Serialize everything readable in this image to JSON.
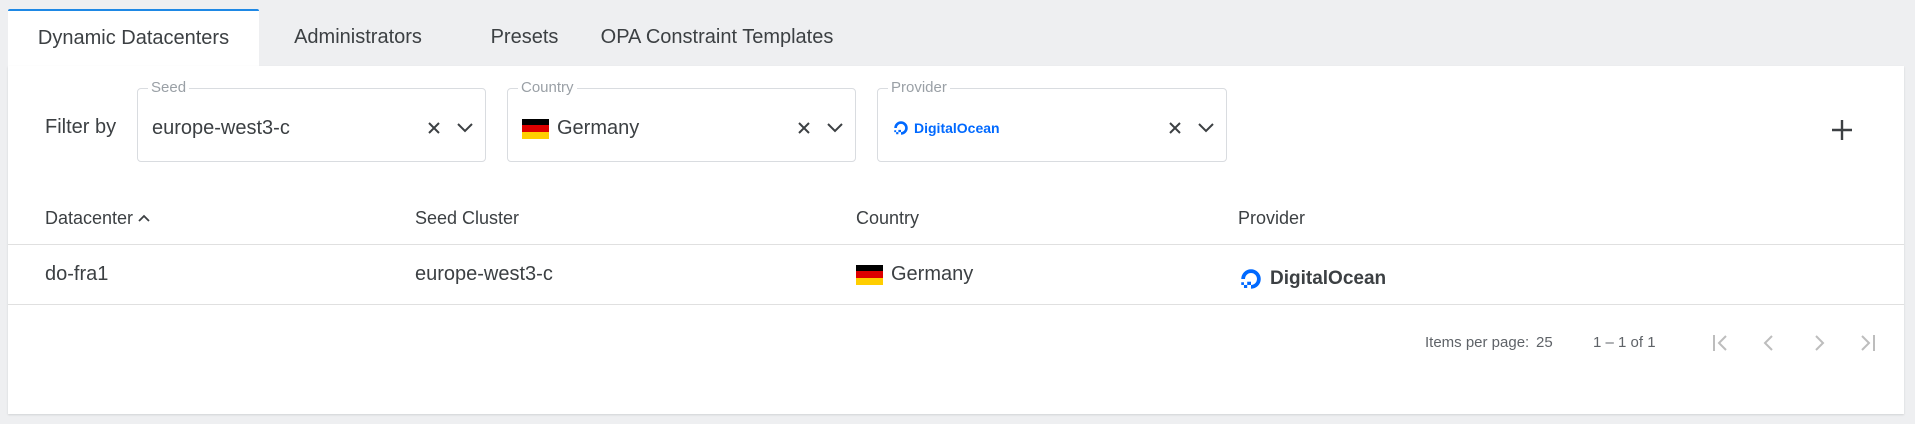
{
  "tabs": [
    {
      "label": "Dynamic Datacenters"
    },
    {
      "label": "Administrators"
    },
    {
      "label": "Presets"
    },
    {
      "label": "OPA Constraint Templates"
    }
  ],
  "filter": {
    "label": "Filter by",
    "seed": {
      "label": "Seed",
      "value": "europe-west3-c"
    },
    "country": {
      "label": "Country",
      "value": "Germany"
    },
    "provider": {
      "label": "Provider",
      "value": "DigitalOcean"
    }
  },
  "table": {
    "columns": [
      "Datacenter",
      "Seed Cluster",
      "Country",
      "Provider"
    ],
    "rows": [
      {
        "datacenter": "do-fra1",
        "seed": "europe-west3-c",
        "country": "Germany",
        "provider": "DigitalOcean"
      }
    ]
  },
  "pagination": {
    "items_per_page_label": "Items per page:",
    "items_per_page": "25",
    "range": "1 – 1 of 1"
  },
  "colors": {
    "accent": "#1e88e5",
    "digitalocean": "#0069ff"
  },
  "icons": {
    "clear": "close-icon",
    "dropdown": "chevron-down-icon",
    "add": "plus-icon",
    "sort": "sort-ascending-icon",
    "pager": [
      "first-page-icon",
      "previous-page-icon",
      "next-page-icon",
      "last-page-icon"
    ]
  }
}
